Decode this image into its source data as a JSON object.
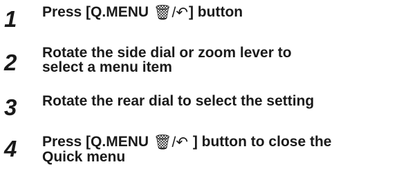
{
  "steps": [
    {
      "number": "1",
      "text_before": "Press [Q.MENU ",
      "icon": "🗑/↶",
      "text_after": "] button"
    },
    {
      "number": "2",
      "line1": "Rotate the side dial or zoom lever to",
      "line2": "select a menu item"
    },
    {
      "number": "3",
      "text": "Rotate the rear dial to select the setting"
    },
    {
      "number": "4",
      "text_before": "Press [Q.MENU ",
      "icon": "🗑/↶",
      "text_after": " ] button to close the",
      "line2": "Quick menu"
    }
  ]
}
